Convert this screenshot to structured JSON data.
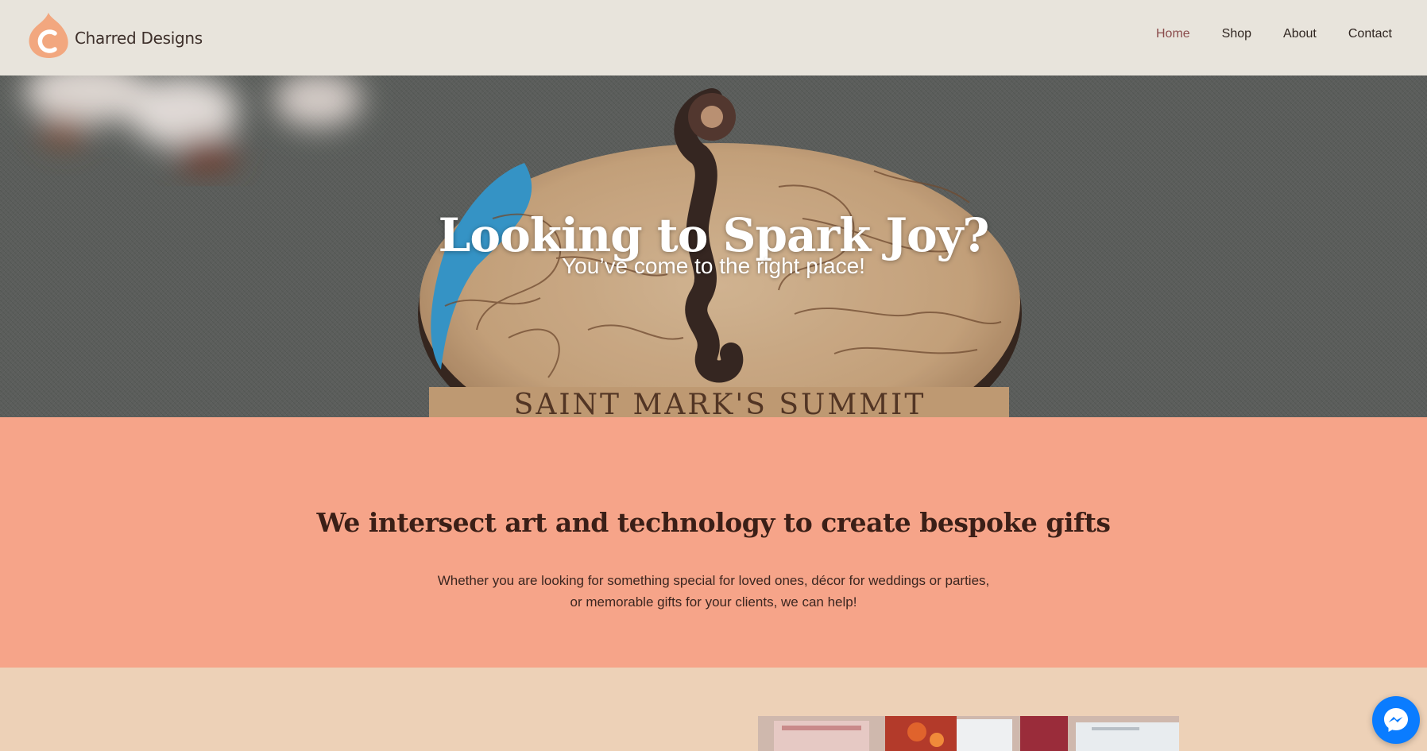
{
  "header": {
    "brand": "Charred Designs",
    "nav": [
      {
        "label": "Home",
        "active": true
      },
      {
        "label": "Shop",
        "active": false
      },
      {
        "label": "About",
        "active": false
      },
      {
        "label": "Contact",
        "active": false
      }
    ]
  },
  "hero": {
    "title": "Looking to Spark Joy?",
    "subtitle": "You’ve come to the right place!",
    "coaster_engraving": "SAINT MARK'S SUMMIT"
  },
  "intro": {
    "heading": "We intersect art and technology to create bespoke gifts",
    "body_line1": "Whether you are looking for something special for loved ones, décor for weddings or parties,",
    "body_line2": "or memorable gifts for your clients, we can help!"
  },
  "icons": {
    "logo": "flame-c-logo-icon",
    "chat": "messenger-icon"
  },
  "colors": {
    "header_bg": "#e8e4dc",
    "nav_active": "#8a4b4b",
    "intro_bg": "#f6a489",
    "lower_bg": "#edd1b7",
    "logo_orange": "#f2a77f",
    "messenger_blue": "#0a7cff"
  }
}
